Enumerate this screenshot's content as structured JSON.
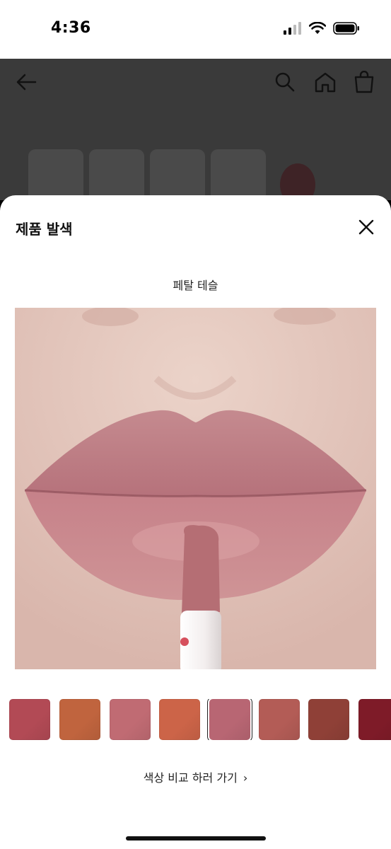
{
  "status_bar": {
    "time": "4:36"
  },
  "sheet": {
    "title": "제품 발색",
    "shade_name": "페탈 테슬",
    "compare_link": "색상 비교 하러 가기",
    "compare_chevron": "›"
  },
  "swatches": [
    {
      "color": "#b24a55",
      "selected": false
    },
    {
      "color": "#c0643e",
      "selected": false
    },
    {
      "color": "#c06b73",
      "selected": false
    },
    {
      "color": "#cc6448",
      "selected": false
    },
    {
      "color": "#b86673",
      "selected": true
    },
    {
      "color": "#b35c56",
      "selected": false
    },
    {
      "color": "#8f4037",
      "selected": false
    },
    {
      "color": "#7e1b28",
      "selected": false
    }
  ],
  "colors": {
    "overlay": "#3a3a3a",
    "sheet": "#ffffff",
    "text": "#111111"
  }
}
